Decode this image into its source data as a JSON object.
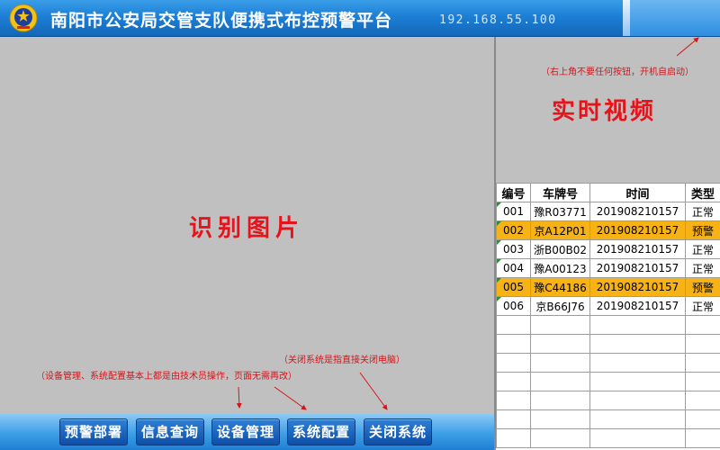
{
  "header": {
    "title": "南阳市公安局交管支队便携式布控预警平台",
    "ip": "192.168.55.100",
    "emblem_icon": "police-emblem-icon"
  },
  "recognition": {
    "label": "识别图片"
  },
  "video": {
    "hint": "（右上角不要任何按钮，开机自启动）",
    "label": "实时视频"
  },
  "table": {
    "columns": [
      "编号",
      "车牌号",
      "时间",
      "类型"
    ],
    "rows": [
      {
        "id": "001",
        "plate": "豫R03771",
        "time": "201908210157",
        "type": "正常",
        "warn": false
      },
      {
        "id": "002",
        "plate": "京A12P01",
        "time": "201908210157",
        "type": "预警",
        "warn": true
      },
      {
        "id": "003",
        "plate": "浙B00B02",
        "time": "201908210157",
        "type": "正常",
        "warn": false
      },
      {
        "id": "004",
        "plate": "豫A00123",
        "time": "201908210157",
        "type": "正常",
        "warn": false
      },
      {
        "id": "005",
        "plate": "豫C44186",
        "time": "201908210157",
        "type": "预警",
        "warn": true
      },
      {
        "id": "006",
        "plate": "京B66J76",
        "time": "201908210157",
        "type": "正常",
        "warn": false
      }
    ],
    "empty_rows": 7,
    "warn_color": "#f7b316"
  },
  "notes": {
    "admin": "（设备管理、系统配置基本上都是由技术员操作，页面无需再改）",
    "shutdown": "（关闭系统是指直接关闭电脑）"
  },
  "buttons": [
    "预警部署",
    "信息查询",
    "设备管理",
    "系统配置",
    "关闭系统"
  ],
  "colors": {
    "title_text": "#ffffff",
    "label_red": "#e8131a",
    "button_bg": "#1a63be"
  }
}
